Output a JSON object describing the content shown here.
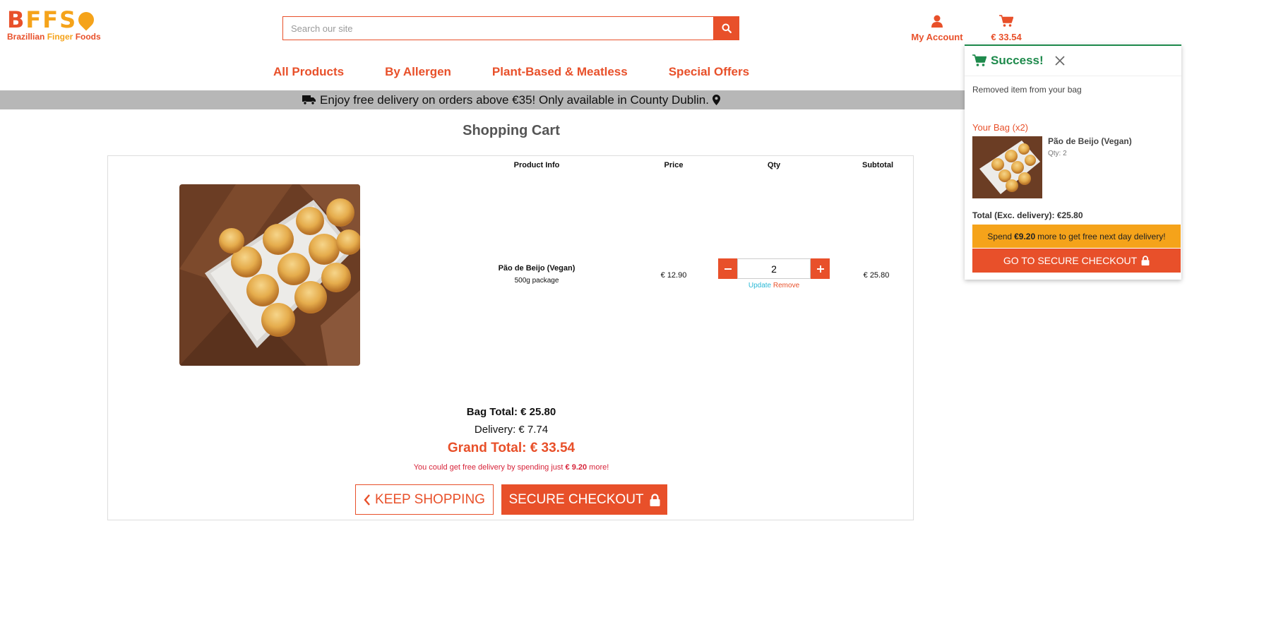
{
  "logo": {
    "word_b": "B",
    "word_ffs": "FFS",
    "sub_a": "Brazillian ",
    "sub_b": "Finger",
    "sub_c": " Foods"
  },
  "search": {
    "placeholder": "Search our site"
  },
  "header": {
    "account_label": "My Account",
    "cart_total": "€ 33.54"
  },
  "nav": {
    "items": [
      "All Products",
      "By Allergen",
      "Plant-Based & Meatless",
      "Special Offers"
    ]
  },
  "banner": {
    "text": "Enjoy free delivery on orders above €35! Only available in County Dublin."
  },
  "cart": {
    "title": "Shopping Cart",
    "columns": {
      "product": "Product Info",
      "price": "Price",
      "qty": "Qty",
      "subtotal": "Subtotal"
    },
    "item": {
      "name": "Pão de Beijo (Vegan)",
      "variant": "500g package",
      "price": "€ 12.90",
      "quantity": "2",
      "subtotal": "€ 25.80",
      "update_label": "Update",
      "remove_label": "Remove"
    },
    "bag_total": "Bag Total: € 25.80",
    "delivery": "Delivery: € 7.74",
    "grand_total": "Grand Total: € 33.54",
    "free_msg_prefix": "You could get free delivery by spending just ",
    "free_msg_amount": "€ 9.20",
    "free_msg_suffix": " more!",
    "keep_shopping": "KEEP SHOPPING",
    "secure_checkout": "SECURE CHECKOUT"
  },
  "popup": {
    "title": "Success!",
    "message": "Removed item from your bag",
    "bag_label": "Your Bag (x2)",
    "item_name": "Pão de Beijo (Vegan)",
    "item_qty": "Qty: 2",
    "total": "Total (Exc. delivery): €25.80",
    "spend_prefix": "Spend",
    "spend_amount": "€9.20",
    "spend_suffix": "more to get free next day delivery!",
    "checkout": "GO TO SECURE CHECKOUT"
  },
  "colors": {
    "brand": "#e8502a",
    "accent": "#f5a31a",
    "success": "#1e8a4c",
    "banner_bg": "#b7b7b7"
  }
}
